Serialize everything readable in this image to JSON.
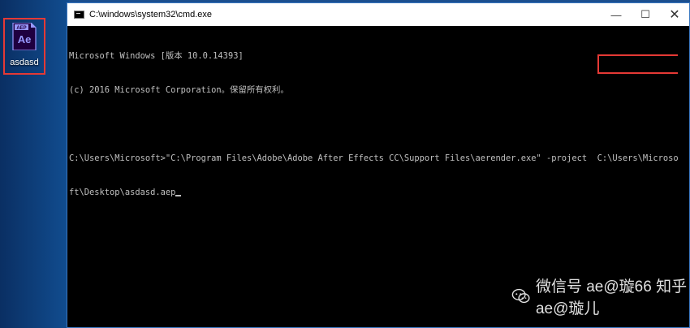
{
  "desktop": {
    "icon": {
      "badge": "AEP",
      "glyph": "Ae",
      "label": "asdasd",
      "icon_name": "after-effects-project-icon"
    }
  },
  "window": {
    "title": "C:\\windows\\system32\\cmd.exe",
    "controls": {
      "minimize": "—",
      "maximize": "☐",
      "close": "✕"
    }
  },
  "console": {
    "lines": [
      "Microsoft Windows [版本 10.0.14393]",
      "(c) 2016 Microsoft Corporation。保留所有权利。",
      "",
      "C:\\Users\\Microsoft>\"C:\\Program Files\\Adobe\\Adobe After Effects CC\\Support Files\\aerender.exe\" -project  C:\\Users\\Microso",
      "ft\\Desktop\\asdasd.aep"
    ]
  },
  "watermark": {
    "text": "微信号 ae@璇66 知乎 ae@璇儿"
  },
  "colors": {
    "highlight": "#e53935",
    "console_bg": "#000000",
    "console_text": "#c0c0c0",
    "ae_purple": "#9999ff",
    "ae_dark": "#1f0040"
  }
}
